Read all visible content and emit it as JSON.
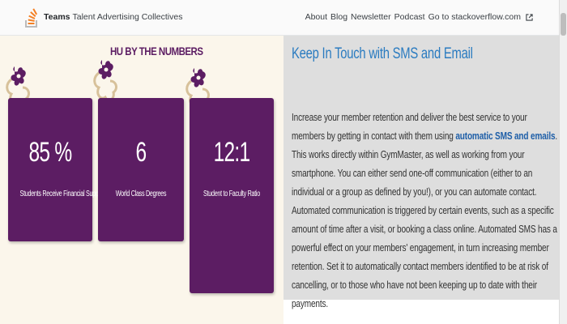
{
  "topbar": {
    "brand_bold": "Teams",
    "brand_rest": "Talent Advertising Collectives",
    "links": [
      "About",
      "Blog",
      "Newsletter",
      "Podcast",
      "Go to stackoverflow.com"
    ],
    "logo_icon": "stackoverflow-logo-icon",
    "external_icon": "external-link-icon"
  },
  "numbers": {
    "title": "HU BY THE NUMBERS",
    "stats": [
      {
        "value": "85 %",
        "label": "Students Receive Financial Support"
      },
      {
        "value": "6",
        "label": "World Class Degrees"
      },
      {
        "value": "12:1",
        "label": "Student to Faculty Ratio"
      }
    ]
  },
  "contact": {
    "title": "Keep In Touch with SMS and Email",
    "text_before_link": "Increase your member retention and deliver the best service to your members by getting in contact with them using ",
    "link_text": "automatic SMS and emails",
    "text_after_link": ". This works directly within GymMaster, as well as working from your smartphone. You can either send one-off communication (either to an individual or a group as defined by you!), or you can automate contact. Automated communication is triggered by certain events, such as a specific amount of time after a visit, or booking a class online. Automated SMS has a powerful effect on your members' engagement, in turn increasing member retention. Set it to automatically contact members identified to be at risk of cancelling, or to those who have not been keeping up to date with their payments."
  },
  "colors": {
    "card_purple": "#5c1d63",
    "link_blue": "#2a7bc0",
    "left_bg": "#fbf6eb",
    "right_bg": "#dedede"
  }
}
